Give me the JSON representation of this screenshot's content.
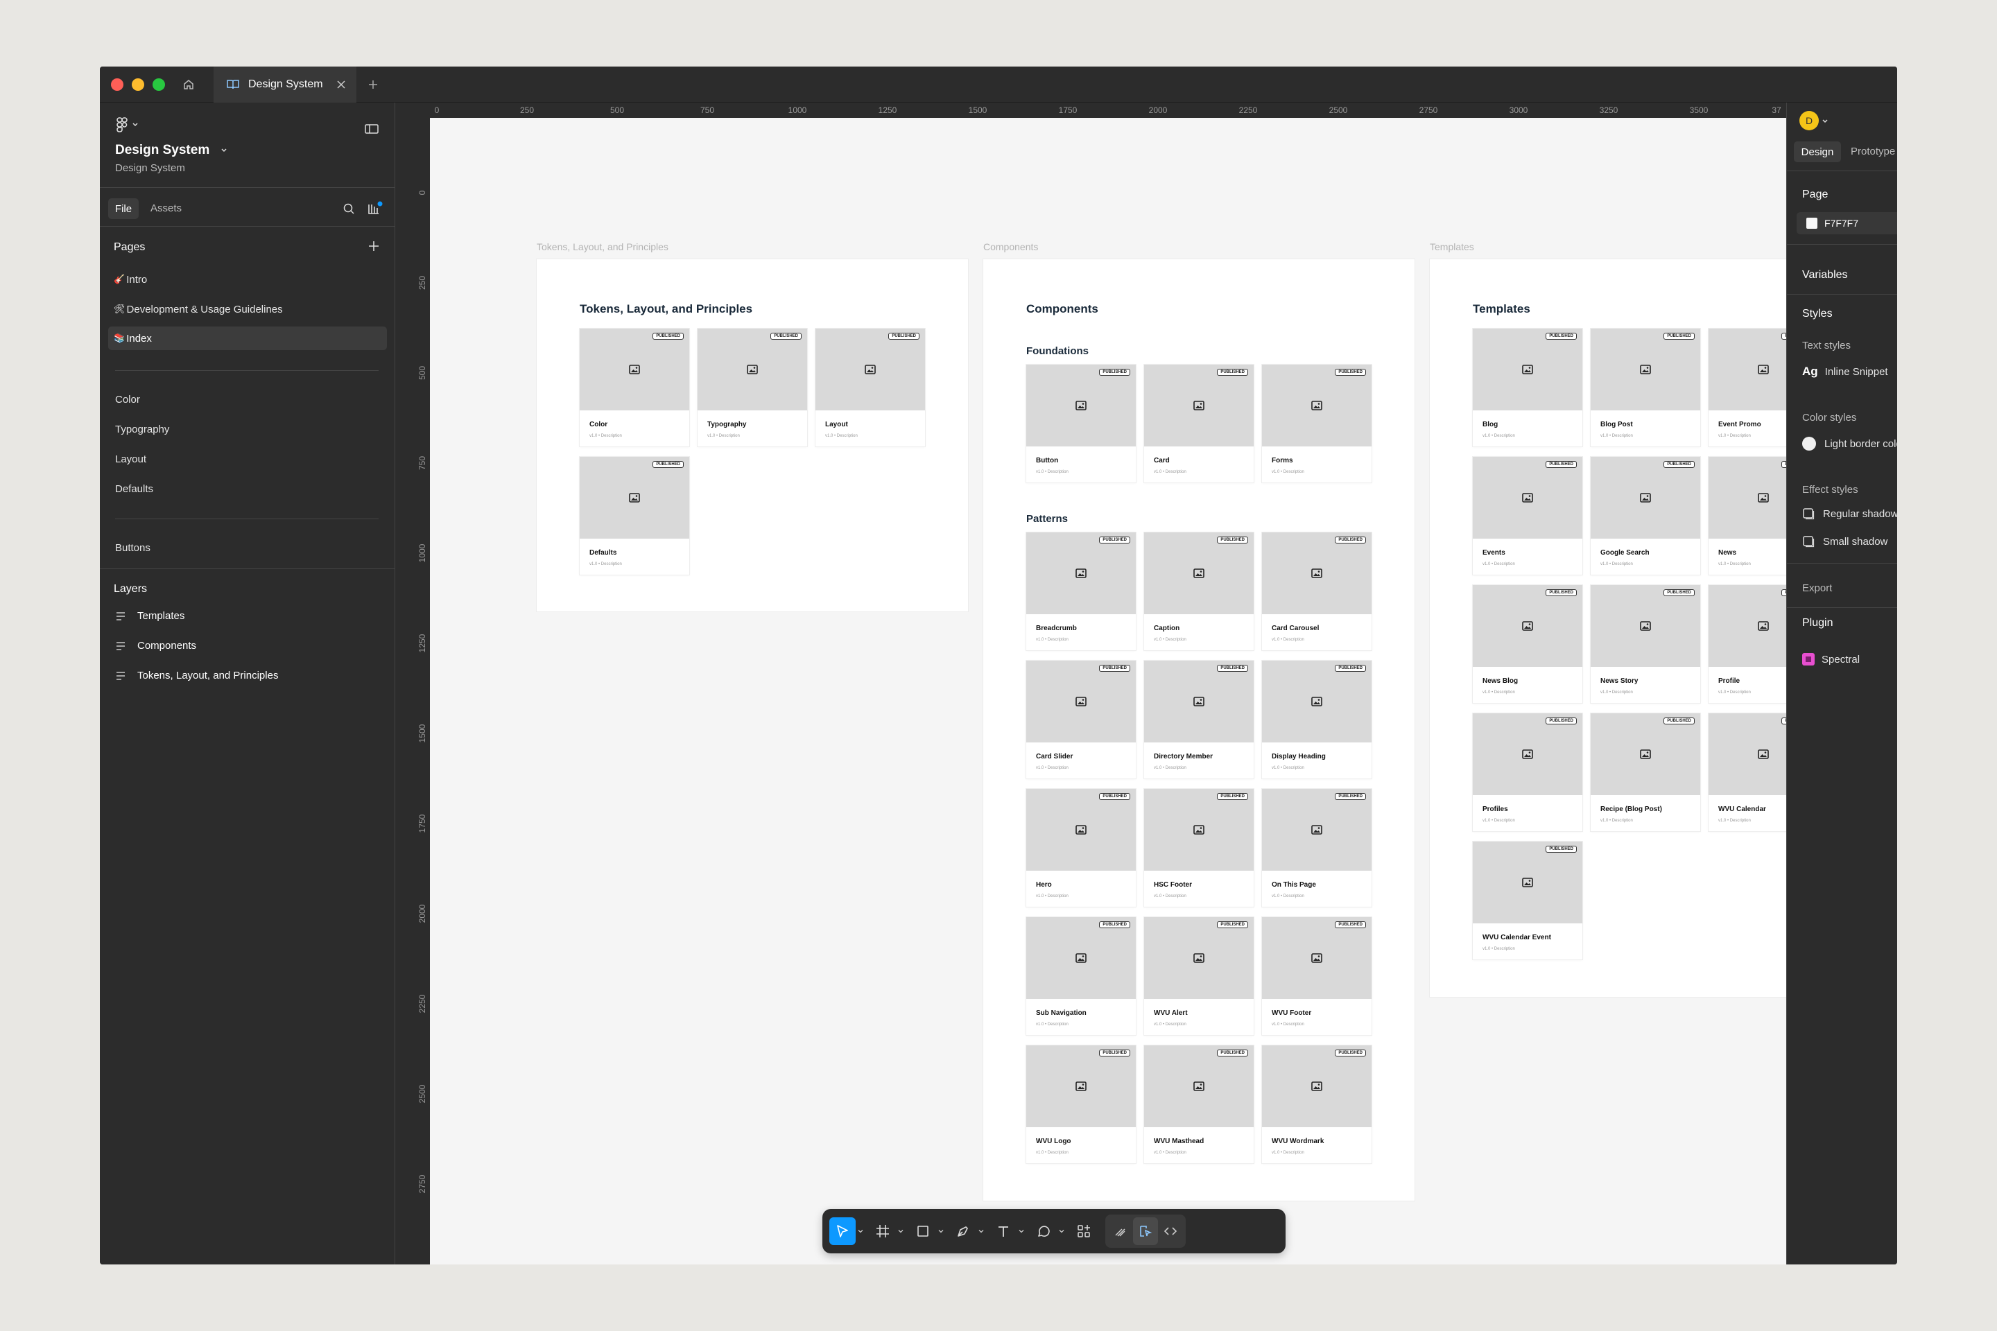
{
  "tabs": {
    "active": "Design System"
  },
  "file": {
    "name": "Design System",
    "project": "Design System"
  },
  "left_panel": {
    "tabs": [
      "File",
      "Assets"
    ],
    "pages_label": "Pages",
    "pages": [
      {
        "emoji": "🎸",
        "label": "Intro"
      },
      {
        "emoji": "🛠",
        "label": "Development & Usage Guidelines"
      },
      {
        "emoji": "📚",
        "label": "Index"
      }
    ],
    "page_links": [
      "Color",
      "Typography",
      "Layout",
      "Defaults"
    ],
    "page_links2": [
      "Buttons"
    ],
    "layers_label": "Layers",
    "layers": [
      "Templates",
      "Components",
      "Tokens, Layout, and Principles"
    ]
  },
  "ruler": {
    "top": [
      "0",
      "250",
      "500",
      "750",
      "1000",
      "1250",
      "1500",
      "1750",
      "2000",
      "2250",
      "2500",
      "2750",
      "3000",
      "3250",
      "3500",
      "37"
    ],
    "left": [
      "0",
      "250",
      "500",
      "750",
      "1000",
      "1250",
      "1500",
      "1750",
      "2000",
      "2250",
      "2500",
      "2750"
    ]
  },
  "frames": [
    {
      "label": "Tokens, Layout, and Principles",
      "title": "Tokens, Layout, and Principles",
      "sections": [
        {
          "name": "",
          "cards": [
            "Color",
            "Typography",
            "Layout",
            "Defaults"
          ]
        }
      ]
    },
    {
      "label": "Components",
      "title": "Components",
      "sections": [
        {
          "name": "Foundations",
          "cards": [
            "Button",
            "Card",
            "Forms"
          ]
        },
        {
          "name": "Patterns",
          "cards": [
            "Breadcrumb",
            "Caption",
            "Card Carousel",
            "Card Slider",
            "Directory Member",
            "Display Heading",
            "Hero",
            "HSC Footer",
            "On This Page",
            "Sub Navigation",
            "WVU Alert",
            "WVU Footer",
            "WVU Logo",
            "WVU Masthead",
            "WVU Wordmark"
          ]
        }
      ]
    },
    {
      "label": "Templates",
      "title": "Templates",
      "sections": [
        {
          "name": "",
          "cards": [
            "Blog",
            "Blog Post",
            "Event Promo",
            "Events",
            "Google Search",
            "News",
            "News Blog",
            "News Story",
            "Profile",
            "Profiles",
            "Recipe (Blog Post)",
            "WVU Calendar",
            "WVU Calendar Event"
          ]
        }
      ]
    }
  ],
  "card": {
    "badge": "PUBLISHED",
    "meta": "v1.0  •  Description"
  },
  "right_panel": {
    "avatar": "D",
    "tabs": [
      "Design",
      "Prototype"
    ],
    "page_label": "Page",
    "page_color": "F7F7F7",
    "variables": "Variables",
    "styles": "Styles",
    "text_styles": "Text styles",
    "text_style_glyph": "Ag",
    "text_style": "Inline Snippet",
    "color_styles": "Color styles",
    "color_style": "Light border color",
    "effect_styles": "Effect styles",
    "effects": [
      "Regular shadow",
      "Small shadow"
    ],
    "export": "Export",
    "plugin": "Plugin",
    "plugin_name": "Spectral"
  },
  "colors": {
    "accent": "#0d99ff",
    "avatar": "#f5c518",
    "plugin": "#e84fd0"
  }
}
